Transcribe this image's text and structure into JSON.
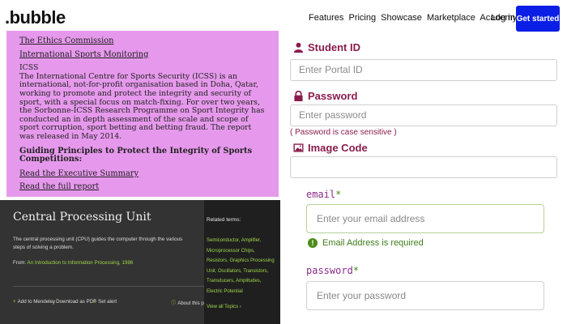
{
  "nav": {
    "logo": ".bubble",
    "links": [
      "Features",
      "Pricing",
      "Showcase",
      "Marketplace",
      "Academy"
    ],
    "login": "Log in",
    "cta": "Get started"
  },
  "article": {
    "link1": "The Ethics Commission",
    "link2": "International Sports Monitoring",
    "heading": "ICSS",
    "para": "The International Centre for Sports Security (ICSS) is an international, not-for-profit organisation based in Doha, Qatar, working to promote and protect the integrity and security of sport, with a special focus on match-fixing. For over two years, the Sorbonne-ICSS Research Programme on Sport Integrity has conducted an in depth assessment of the scale and scope of sport corruption, sport betting and betting fraud. The report was released in May 2014.",
    "subheading": "Guiding Principles to Protect the Integrity of Sports Competitions:",
    "link3": "Read the Executive Summary",
    "link4": "Read the full report"
  },
  "cpu": {
    "title": "Central Processing Unit",
    "description": "The central processing unit (CPU) guides the computer through the various steps of solving a problem.",
    "from_prefix": "From:",
    "from_link": "An Introduction to Information Processing, 1986",
    "actions": [
      "Add to Mendeley",
      "Download as PDF",
      "Set alert",
      "About this page"
    ],
    "related_title": "Related terms:",
    "related_terms": "Semiconductor, Amplifier, Microprocessor Chips, Resistors, Graphics Processing Unit, Oscillators, Transistors, Transducers, Amplitudes, Electric Potential",
    "view_all": "View all Topics"
  },
  "student_form": {
    "student_id_label": "Student ID",
    "student_id_placeholder": "Enter Portal ID",
    "password_label": "Password",
    "password_placeholder": "Enter password",
    "password_note": "( Password is case sensitive )",
    "image_code_label": "Image Code",
    "image_code_value": ""
  },
  "account_form": {
    "email_label": "email",
    "required_mark": "*",
    "email_placeholder": "Enter your email address",
    "email_error": "Email Address is required",
    "password_label": "password",
    "password_placeholder": "Enter your password"
  },
  "colors": {
    "cta_blue": "#0a1ee6",
    "purple_panel": "#e699ec",
    "form_label": "#8a1c4d",
    "success_green": "#4c8c1a"
  }
}
